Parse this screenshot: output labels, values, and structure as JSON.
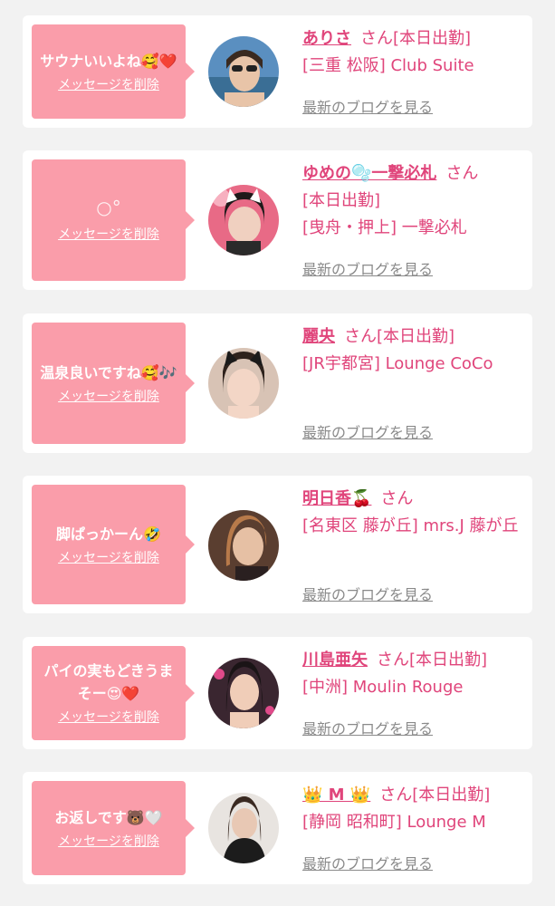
{
  "delete_label": "メッセージを削除",
  "blog_label": "最新のブログを見る",
  "san_label": "さん",
  "cards": [
    {
      "message": "サウナいいよね🥰❤️",
      "name": "ありさ",
      "status": "[本日出勤]",
      "store": "[三重 松阪] Club Suite"
    },
    {
      "message": "",
      "message_icon": "bubbles-icon",
      "name": "ゆめの🫧一撃必札",
      "status": "[本日出勤]",
      "store": "[曳舟・押上] 一撃必札"
    },
    {
      "message": "温泉良いですね🥰🎶",
      "name": "麗央",
      "status": "[本日出勤]",
      "store": "[JR宇都宮] Lounge CoCo"
    },
    {
      "message": "脚ぱっかーん🤣",
      "name": "明日香🍒",
      "status": "",
      "store": "[名東区 藤が丘] mrs.J 藤が丘"
    },
    {
      "message": "パイの実もどきうまそー😍❤️",
      "name": "川島亜矢",
      "status": "[本日出勤]",
      "store": "[中洲] Moulin Rouge"
    },
    {
      "message": "お返しです🐻🤍",
      "name": "👑 M 👑",
      "status": "[本日出勤]",
      "store": "[静岡 昭和町] Lounge M"
    }
  ],
  "colors": {
    "background": "#f2f2f2",
    "bubble": "#fa9daa",
    "accent": "#e0457b",
    "blog_link": "#8a8a8a"
  }
}
